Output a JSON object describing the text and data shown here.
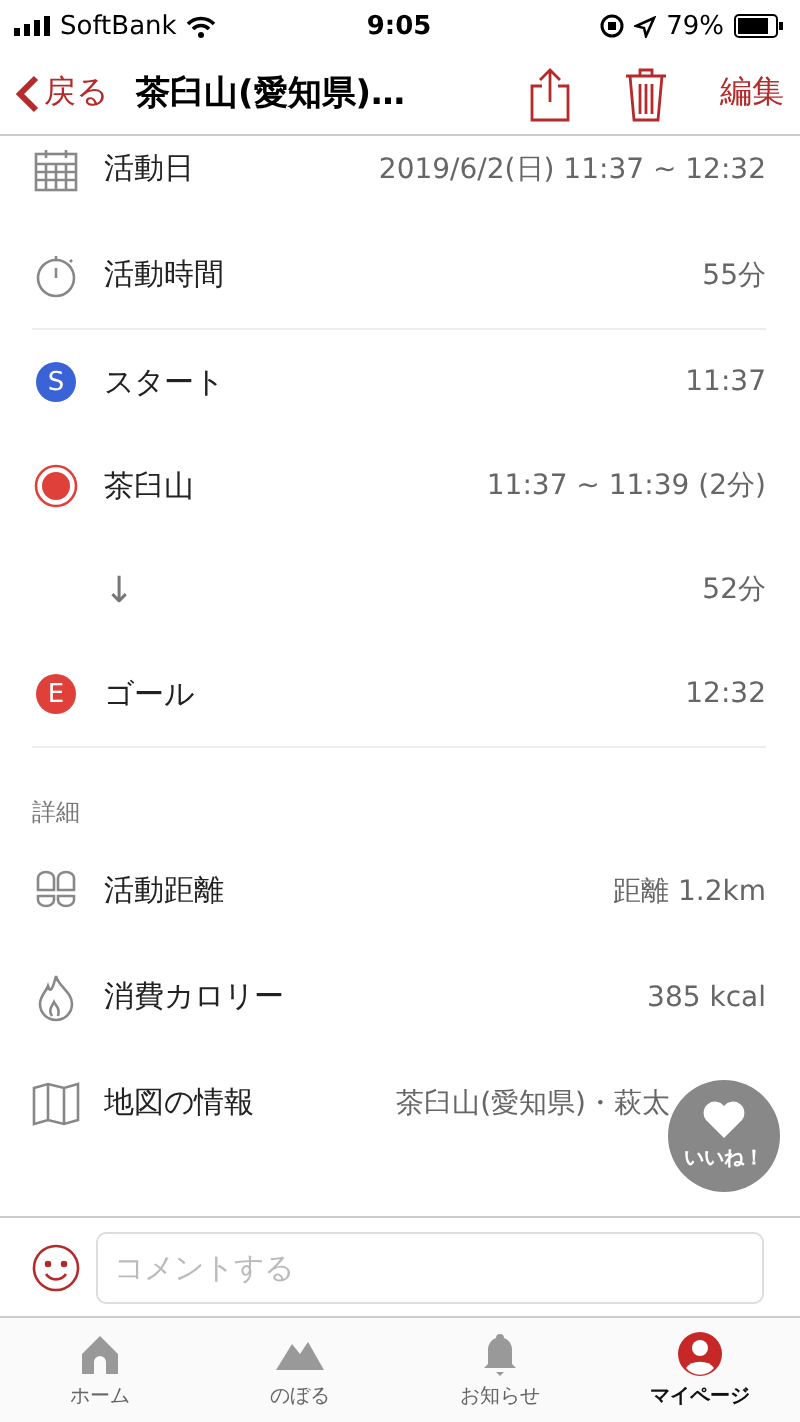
{
  "status_bar": {
    "carrier": "SoftBank",
    "time": "9:05",
    "battery": "79%"
  },
  "nav": {
    "back": "戻る",
    "title": "茶臼山(愛知県)…",
    "edit": "編集"
  },
  "sections": [
    {
      "rows": [
        {
          "kind": "calendar",
          "label": "活動日",
          "value": "2019/6/2(日) 11:37 ~ 12:32"
        },
        {
          "kind": "stopwatch",
          "label": "活動時間",
          "value": "55分"
        }
      ]
    },
    {
      "rows": [
        {
          "kind": "badge",
          "badge": "S",
          "color": "#3a63d8",
          "label": "スタート",
          "value": "11:37"
        },
        {
          "kind": "point",
          "label": "茶臼山",
          "value": "11:37 ~ 11:39 (2分)"
        },
        {
          "kind": "arrow",
          "arrow": "↓",
          "value": "52分"
        },
        {
          "kind": "badge",
          "badge": "E",
          "color": "#e0403a",
          "label": "ゴール",
          "value": "12:32"
        }
      ]
    },
    {
      "header": "詳細",
      "rows": [
        {
          "kind": "footprints",
          "label": "活動距離",
          "value": "距離 1.2km"
        },
        {
          "kind": "flame",
          "label": "消費カロリー",
          "value": "385 kcal"
        },
        {
          "kind": "map",
          "label": "地図の情報",
          "value": "茶臼山(愛知県)・萩太"
        }
      ]
    }
  ],
  "like": {
    "label": "いいね！"
  },
  "comment": {
    "placeholder": "コメントする"
  },
  "tabs": [
    {
      "kind": "home",
      "label": "ホーム",
      "selected": false
    },
    {
      "kind": "mountain",
      "label": "のぼる",
      "selected": false
    },
    {
      "kind": "bell",
      "label": "お知らせ",
      "selected": false
    },
    {
      "kind": "user",
      "label": "マイページ",
      "selected": true
    }
  ]
}
